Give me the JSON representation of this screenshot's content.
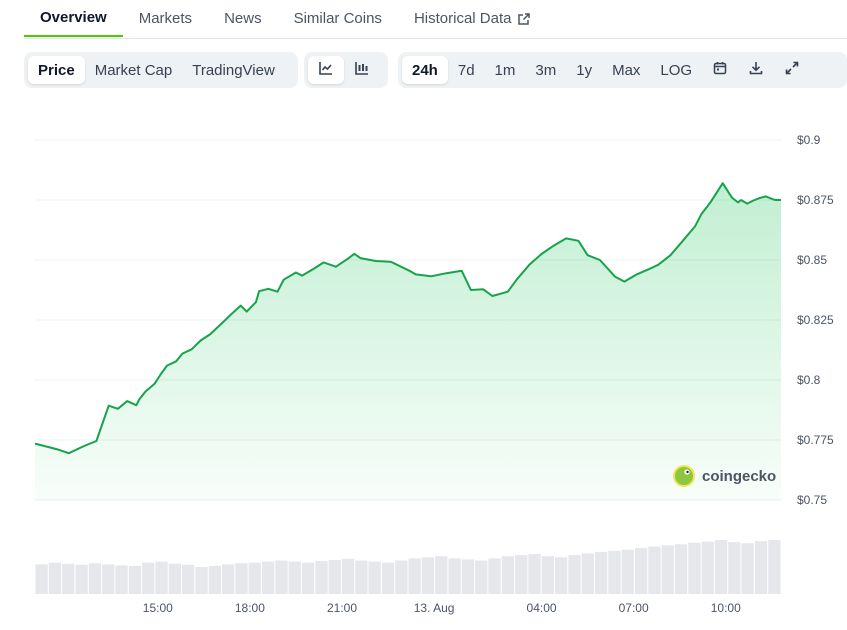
{
  "nav": {
    "tabs": [
      {
        "label": "Overview",
        "active": true
      },
      {
        "label": "Markets"
      },
      {
        "label": "News"
      },
      {
        "label": "Similar Coins"
      },
      {
        "label": "Historical Data",
        "icon": "external-link-icon"
      }
    ]
  },
  "toolbar": {
    "chart_modes": [
      "Price",
      "Market Cap",
      "TradingView"
    ],
    "active_mode": "Price",
    "chart_styles": [
      {
        "icon": "line-chart-icon",
        "active": true
      },
      {
        "icon": "candlestick-chart-icon",
        "active": false
      }
    ],
    "ranges": [
      "24h",
      "7d",
      "1m",
      "3m",
      "1y",
      "Max",
      "LOG"
    ],
    "active_range": "24h",
    "actions": [
      "calendar-icon",
      "download-icon",
      "fullscreen-icon"
    ]
  },
  "watermark": {
    "text": "coingecko",
    "icon": "coingecko-logo-icon"
  },
  "colors": {
    "line": "#16a34a",
    "accent": "#4bcc00",
    "volume": "#e5e7eb"
  },
  "chart_data": {
    "type": "area",
    "x_tick_labels": [
      "15:00",
      "18:00",
      "21:00",
      "13. Aug",
      "04:00",
      "07:00",
      "10:00"
    ],
    "x_tick_hours": [
      3.5,
      6.5,
      9.5,
      12.5,
      16.0,
      19.0,
      22.0
    ],
    "y_tick_labels": [
      "$0.9",
      "$0.875",
      "$0.85",
      "$0.825",
      "$0.8",
      "$0.775",
      "$0.75"
    ],
    "y_tick_values": [
      0.9,
      0.875,
      0.85,
      0.825,
      0.8,
      0.775,
      0.75
    ],
    "ylim": [
      0.75,
      0.9
    ],
    "xlim_hours": [
      -0.5,
      23.8
    ],
    "series": [
      {
        "x_hours": [
          -0.5,
          0.2,
          0.6,
          1.1,
          1.5,
          1.9,
          2.2,
          2.5,
          2.8,
          2.9,
          3.1,
          3.4,
          3.6,
          3.8,
          4.1,
          4.3,
          4.6,
          4.9,
          5.2,
          5.6,
          5.9,
          6.2,
          6.4,
          6.7,
          6.8,
          7.1,
          7.4,
          7.6,
          8.0,
          8.2,
          8.6,
          8.9,
          9.3,
          9.7,
          9.9,
          10.1,
          10.6,
          11.1,
          11.7,
          11.9,
          12.4,
          12.9,
          13.4,
          13.7,
          14.1,
          14.4,
          14.9,
          15.2,
          15.6,
          16.0,
          16.4,
          16.8,
          17.2,
          17.5,
          17.9,
          18.4,
          18.7,
          19.1,
          19.5,
          19.8,
          20.2,
          20.6,
          21.0,
          21.2,
          21.5,
          21.9,
          22.2,
          22.4,
          22.5,
          22.7,
          22.9,
          23.1,
          23.3,
          23.6,
          23.8
        ],
        "y": [
          0.7735,
          0.7712,
          0.7695,
          0.7725,
          0.7746,
          0.7893,
          0.788,
          0.7912,
          0.7895,
          0.792,
          0.7952,
          0.7985,
          0.8025,
          0.806,
          0.8078,
          0.811,
          0.8128,
          0.8165,
          0.819,
          0.8238,
          0.8275,
          0.831,
          0.8285,
          0.8325,
          0.837,
          0.838,
          0.8368,
          0.8418,
          0.8448,
          0.8435,
          0.8465,
          0.849,
          0.8472,
          0.8506,
          0.8526,
          0.8508,
          0.8496,
          0.8492,
          0.8455,
          0.844,
          0.8432,
          0.8445,
          0.8455,
          0.8375,
          0.8378,
          0.835,
          0.8368,
          0.842,
          0.848,
          0.8525,
          0.856,
          0.859,
          0.858,
          0.852,
          0.85,
          0.843,
          0.841,
          0.844,
          0.8462,
          0.848,
          0.852,
          0.858,
          0.864,
          0.869,
          0.874,
          0.882,
          0.876,
          0.874,
          0.875,
          0.8735,
          0.8748,
          0.8758,
          0.8765,
          0.875,
          0.875
        ]
      }
    ],
    "volume_relative": [
      0.55,
      0.58,
      0.56,
      0.54,
      0.57,
      0.55,
      0.53,
      0.52,
      0.58,
      0.6,
      0.56,
      0.54,
      0.5,
      0.52,
      0.55,
      0.57,
      0.58,
      0.6,
      0.62,
      0.6,
      0.58,
      0.61,
      0.63,
      0.65,
      0.62,
      0.6,
      0.58,
      0.62,
      0.66,
      0.68,
      0.7,
      0.66,
      0.64,
      0.62,
      0.66,
      0.7,
      0.72,
      0.74,
      0.7,
      0.68,
      0.72,
      0.75,
      0.78,
      0.8,
      0.82,
      0.85,
      0.88,
      0.9,
      0.92,
      0.95,
      0.97,
      1.0,
      0.96,
      0.94,
      0.98,
      1.0
    ]
  }
}
